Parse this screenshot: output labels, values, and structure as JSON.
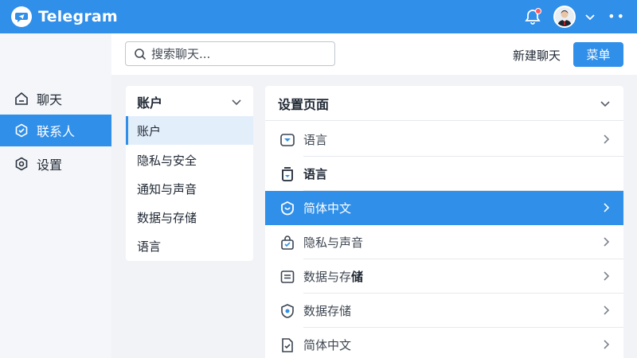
{
  "app": {
    "name": "Telegram"
  },
  "topbar": {
    "icons": [
      "telegram-logo-icon",
      "bell-icon",
      "avatar",
      "chevron-down-icon",
      "more-icon"
    ],
    "more_glyph": "••"
  },
  "leftnav": {
    "items": [
      {
        "label": "聊天",
        "icon": "home-icon"
      },
      {
        "label": "联系人",
        "icon": "contacts-icon",
        "active": true
      },
      {
        "label": "设置",
        "icon": "settings-icon"
      }
    ]
  },
  "header": {
    "search_placeholder": "搜索聊天...",
    "new_chat_label": "新建聊天",
    "menu_label": "菜单"
  },
  "account_panel": {
    "title": "账户",
    "items": [
      "账户",
      "隐私与安全",
      "通知与声音",
      "数据与存储",
      "语言"
    ],
    "selected_index": 0
  },
  "settings_panel": {
    "title": "设置页面",
    "rows": [
      {
        "label": "语言",
        "icon": "language-icon",
        "arrow": true
      },
      {
        "label": "语言",
        "icon": "storage-icon",
        "bold": true,
        "arrow": false
      },
      {
        "label": "简体中文",
        "icon": "chat-bubble-icon",
        "active": true,
        "arrow": true
      },
      {
        "label": "隐私与声音",
        "icon": "lock-check-icon",
        "arrow": true
      },
      {
        "label_prefix": "数据与存",
        "label_bold": "储",
        "icon": "list-icon",
        "arrow": true
      },
      {
        "label": "数据存储",
        "icon": "shield-icon",
        "arrow": true
      },
      {
        "label": "简体中文",
        "icon": "document-icon",
        "arrow": true
      }
    ]
  },
  "colors": {
    "accent": "#2f8fe9",
    "selected_bg": "#e3eefb",
    "badge_red": "#ff5a5f"
  }
}
